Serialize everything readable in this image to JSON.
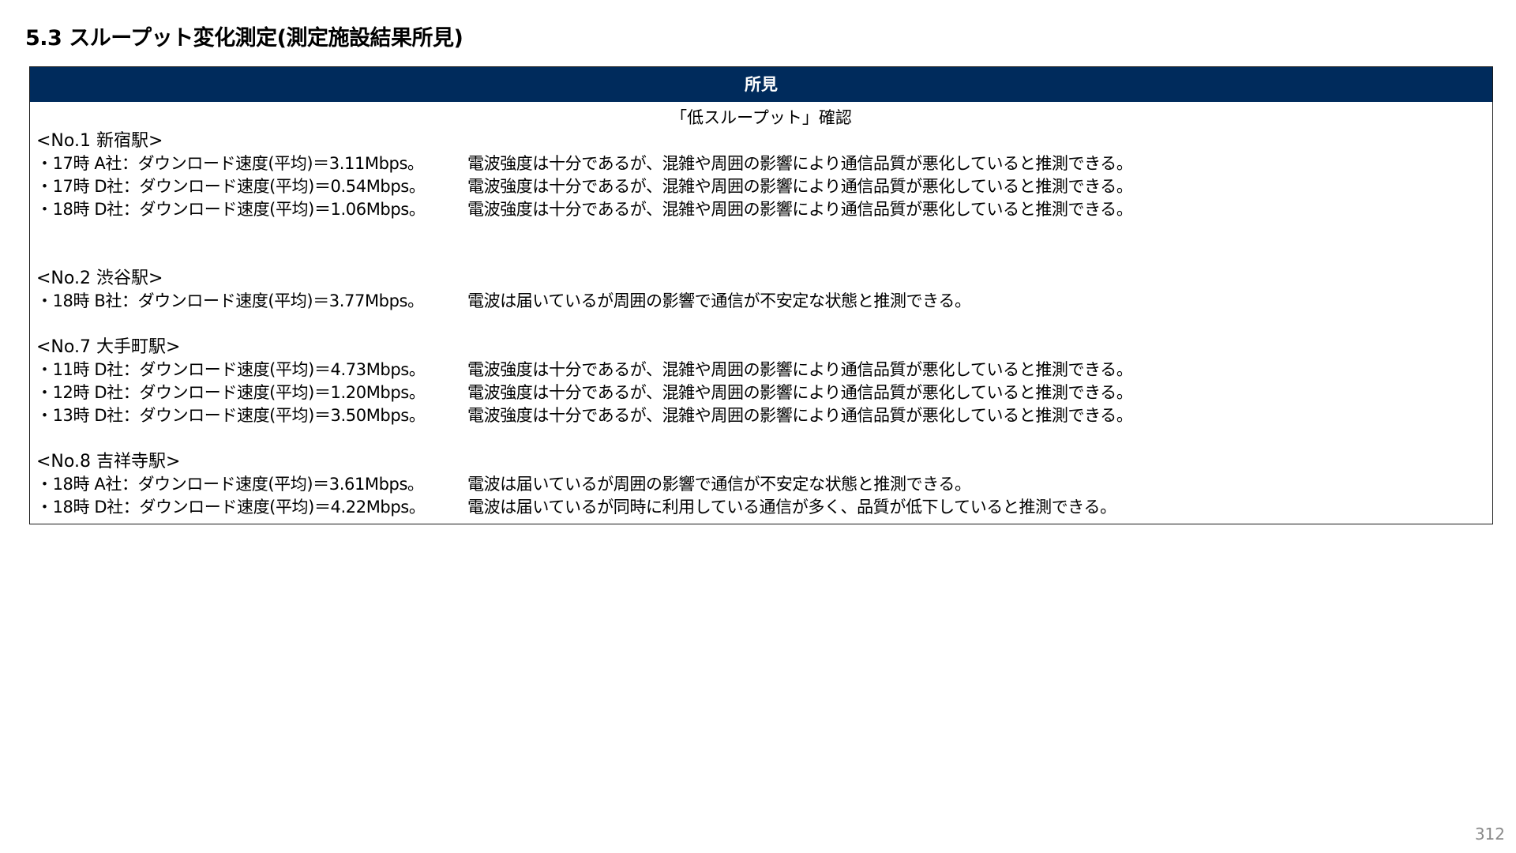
{
  "page": {
    "title": "5.3 スループット変化測定(測定施設結果所見)",
    "page_number": "312"
  },
  "findings": {
    "header": "所見",
    "subtitle": "「低スループット」確認",
    "groups": [
      {
        "station": "<No.1 新宿駅>",
        "entries": [
          {
            "measure": "・17時 A社：ダウンロード速度(平均)＝3.11Mbps。",
            "comment": "電波強度は十分であるが、混雑や周囲の影響により通信品質が悪化していると推測できる。"
          },
          {
            "measure": "・17時 D社：ダウンロード速度(平均)＝0.54Mbps。",
            "comment": "電波強度は十分であるが、混雑や周囲の影響により通信品質が悪化していると推測できる。"
          },
          {
            "measure": "・18時 D社：ダウンロード速度(平均)＝1.06Mbps。",
            "comment": "電波強度は十分であるが、混雑や周囲の影響により通信品質が悪化していると推測できる。"
          }
        ]
      },
      {
        "station": "<No.2 渋谷駅>",
        "entries": [
          {
            "measure": "・18時 B社：ダウンロード速度(平均)＝3.77Mbps。",
            "comment": "電波は届いているが周囲の影響で通信が不安定な状態と推測できる。"
          }
        ]
      },
      {
        "station": "<No.7 大手町駅>",
        "entries": [
          {
            "measure": "・11時 D社：ダウンロード速度(平均)＝4.73Mbps。",
            "comment": "電波強度は十分であるが、混雑や周囲の影響により通信品質が悪化していると推測できる。"
          },
          {
            "measure": "・12時 D社：ダウンロード速度(平均)＝1.20Mbps。",
            "comment": "電波強度は十分であるが、混雑や周囲の影響により通信品質が悪化していると推測できる。"
          },
          {
            "measure": "・13時 D社：ダウンロード速度(平均)＝3.50Mbps。",
            "comment": "電波強度は十分であるが、混雑や周囲の影響により通信品質が悪化していると推測できる。"
          }
        ]
      },
      {
        "station": "<No.8 吉祥寺駅>",
        "entries": [
          {
            "measure": "・18時 A社：ダウンロード速度(平均)＝3.61Mbps。",
            "comment": "電波は届いているが周囲の影響で通信が不安定な状態と推測できる。"
          },
          {
            "measure": "・18時 D社：ダウンロード速度(平均)＝4.22Mbps。",
            "comment": "電波は届いているが同時に利用している通信が多く、品質が低下していると推測できる。"
          }
        ]
      }
    ]
  }
}
